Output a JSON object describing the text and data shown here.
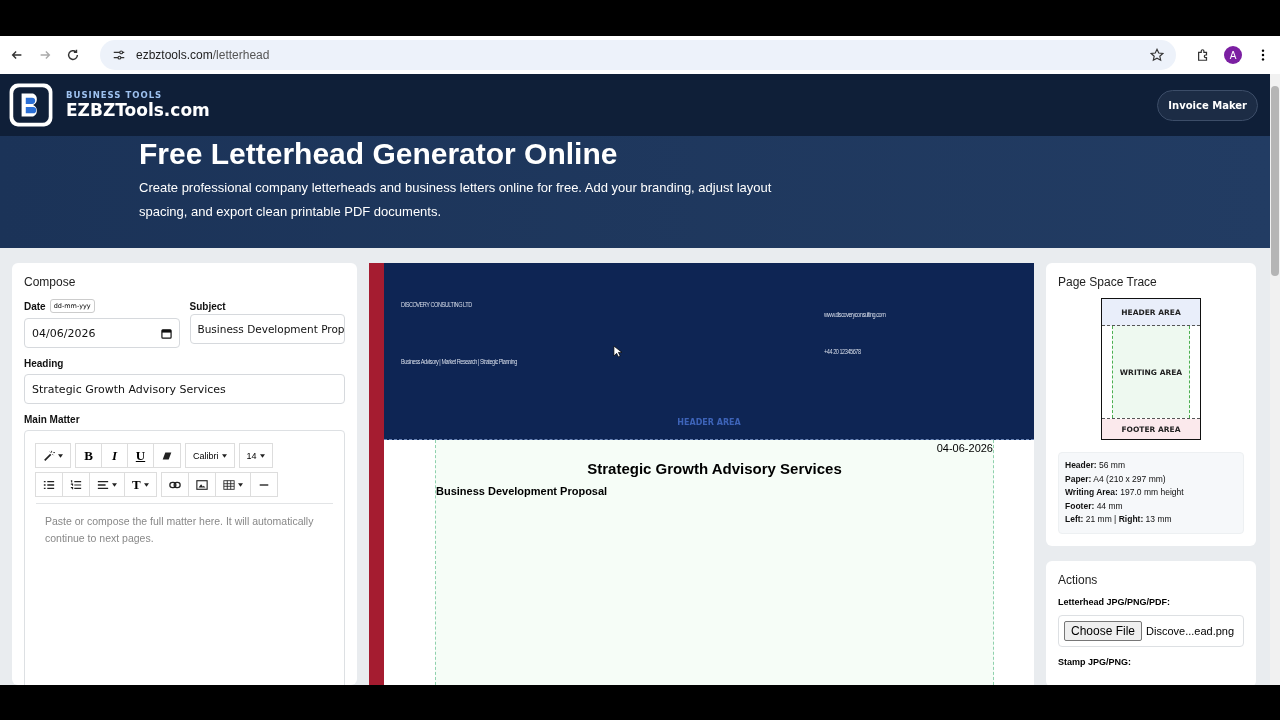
{
  "browser": {
    "url_host": "ezbztools.com",
    "url_path": "/letterhead",
    "avatar": "A"
  },
  "site": {
    "tagline": "BUSINESS TOOLS",
    "name": "EZBZTools.com",
    "nav_button": "Invoice Maker"
  },
  "hero": {
    "title": "Free Letterhead Generator Online",
    "text": "Create professional company letterheads and business letters online for free. Add your branding, adjust layout spacing, and export clean printable PDF documents."
  },
  "compose": {
    "title": "Compose",
    "date_label": "Date",
    "date_format_hint": "dd-mm-yyy",
    "date_value": "04/06/2026",
    "subject_label": "Subject",
    "subject_value": "Business Development Prop",
    "heading_label": "Heading",
    "heading_value": "Strategic Growth Advisory Services",
    "matter_label": "Main Matter",
    "toolbar": [
      [
        {
          "kind": "magic",
          "caret": true
        }
      ],
      [
        {
          "kind": "bold",
          "label": "B",
          "caret": false
        },
        {
          "kind": "italic",
          "label": "I",
          "caret": false
        },
        {
          "kind": "underline",
          "label": "U",
          "caret": false
        },
        {
          "kind": "eraser",
          "caret": false
        }
      ],
      [
        {
          "kind": "text",
          "label": "Calibri",
          "caret": true
        }
      ],
      [
        {
          "kind": "text",
          "label": "14",
          "caret": true
        }
      ]
    ],
    "toolbar_row2": [
      [
        {
          "kind": "bullets",
          "caret": false
        },
        {
          "kind": "numbers",
          "caret": false
        },
        {
          "kind": "align",
          "caret": true
        },
        {
          "kind": "textsize",
          "label": "T",
          "caret": true
        }
      ],
      [
        {
          "kind": "link",
          "caret": false
        },
        {
          "kind": "image",
          "caret": false
        },
        {
          "kind": "table",
          "caret": true
        },
        {
          "kind": "rule",
          "caret": false
        }
      ]
    ],
    "matter_placeholder": "Paste or compose the full matter here. It will automatically continue to next pages."
  },
  "preview": {
    "company": "DISCOVERY CONSULTING LTD",
    "services": "Business Advisory | Market Research | Strategic Planning",
    "website": "www.discoveryconsulting.com",
    "phone": "+44 20 12345678",
    "header_area_label": "HEADER AREA",
    "date": "04-06-2026",
    "heading": "Strategic Growth Advisory Services",
    "subject": "Business Development Proposal"
  },
  "trace": {
    "title": "Page Space Trace",
    "header_label": "HEADER AREA",
    "writing_label": "WRITING AREA",
    "footer_label": "FOOTER AREA",
    "info": [
      "**Header:** 56 mm",
      "**Paper:** A4 (210 x 297 mm)",
      "**Writing Area:** 197.0 mm height",
      "**Footer:** 44 mm",
      "**Left:** 21 mm | **Right:** 13 mm"
    ]
  },
  "actions": {
    "title": "Actions",
    "letterhead_label": "Letterhead JPG/PNG/PDF:",
    "file_button": "Choose File",
    "file_name": "Discove...ead.png",
    "stamp_label": "Stamp JPG/PNG:"
  }
}
